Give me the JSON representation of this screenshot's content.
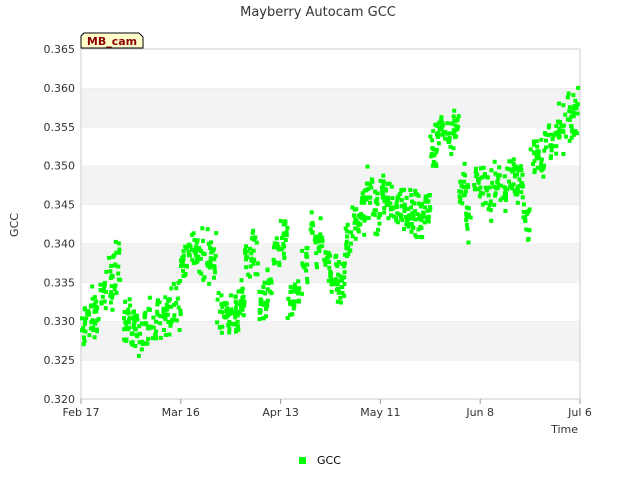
{
  "chart_data": {
    "type": "scatter",
    "title": "Mayberry Autocam GCC",
    "xlabel": "Time",
    "ylabel": "GCC",
    "xlim": [
      "2020-02-17",
      "2020-07-06"
    ],
    "ylim": [
      0.32,
      0.365
    ],
    "x_ticks": [
      {
        "date": "2020-02-17",
        "label": "Feb 17"
      },
      {
        "date": "2020-03-16",
        "label": "Mar 16"
      },
      {
        "date": "2020-04-13",
        "label": "Apr 13"
      },
      {
        "date": "2020-05-11",
        "label": "May 11"
      },
      {
        "date": "2020-06-08",
        "label": "Jun 8"
      },
      {
        "date": "2020-07-06",
        "label": "Jul 6"
      }
    ],
    "y_ticks": [
      "0.320",
      "0.325",
      "0.330",
      "0.335",
      "0.340",
      "0.345",
      "0.350",
      "0.355",
      "0.360",
      "0.365"
    ],
    "alternating_bands": true,
    "legend": {
      "position": "bottom-center",
      "entries": [
        "GCC"
      ]
    },
    "flag_label": "MB_cam",
    "series": [
      {
        "name": "GCC",
        "color": "#00ff00",
        "marker": "square",
        "daily_center": [
          [
            "2020-02-17",
            0.3285
          ],
          [
            "2020-02-19",
            0.33
          ],
          [
            "2020-02-21",
            0.331
          ],
          [
            "2020-02-23",
            0.3325
          ],
          [
            "2020-02-25",
            0.335
          ],
          [
            "2020-02-27",
            0.337
          ],
          [
            "2020-03-01",
            0.33
          ],
          [
            "2020-03-03",
            0.329
          ],
          [
            "2020-03-05",
            0.3285
          ],
          [
            "2020-03-07",
            0.33
          ],
          [
            "2020-03-09",
            0.33
          ],
          [
            "2020-03-11",
            0.331
          ],
          [
            "2020-03-13",
            0.331
          ],
          [
            "2020-03-15",
            0.332
          ],
          [
            "2020-03-17",
            0.337
          ],
          [
            "2020-03-19",
            0.339
          ],
          [
            "2020-03-21",
            0.3385
          ],
          [
            "2020-03-23",
            0.338
          ],
          [
            "2020-03-25",
            0.3385
          ],
          [
            "2020-03-27",
            0.331
          ],
          [
            "2020-03-29",
            0.33
          ],
          [
            "2020-03-31",
            0.331
          ],
          [
            "2020-04-02",
            0.332
          ],
          [
            "2020-04-04",
            0.338
          ],
          [
            "2020-04-06",
            0.3395
          ],
          [
            "2020-04-08",
            0.332
          ],
          [
            "2020-04-10",
            0.335
          ],
          [
            "2020-04-12",
            0.339
          ],
          [
            "2020-04-14",
            0.34
          ],
          [
            "2020-04-16",
            0.332
          ],
          [
            "2020-04-18",
            0.334
          ],
          [
            "2020-04-20",
            0.338
          ],
          [
            "2020-04-22",
            0.341
          ],
          [
            "2020-04-24",
            0.34
          ],
          [
            "2020-04-26",
            0.338
          ],
          [
            "2020-04-28",
            0.336
          ],
          [
            "2020-04-30",
            0.335
          ],
          [
            "2020-05-02",
            0.34
          ],
          [
            "2020-05-04",
            0.343
          ],
          [
            "2020-05-06",
            0.345
          ],
          [
            "2020-05-08",
            0.346
          ],
          [
            "2020-05-10",
            0.344
          ],
          [
            "2020-05-12",
            0.346
          ],
          [
            "2020-05-14",
            0.345
          ],
          [
            "2020-05-16",
            0.345
          ],
          [
            "2020-05-18",
            0.344
          ],
          [
            "2020-05-20",
            0.3445
          ],
          [
            "2020-05-22",
            0.343
          ],
          [
            "2020-05-24",
            0.345
          ],
          [
            "2020-05-26",
            0.353
          ],
          [
            "2020-05-28",
            0.354
          ],
          [
            "2020-05-30",
            0.3535
          ],
          [
            "2020-06-01",
            0.355
          ],
          [
            "2020-06-03",
            0.347
          ],
          [
            "2020-06-05",
            0.343
          ],
          [
            "2020-06-07",
            0.348
          ],
          [
            "2020-06-09",
            0.3475
          ],
          [
            "2020-06-11",
            0.346
          ],
          [
            "2020-06-13",
            0.348
          ],
          [
            "2020-06-15",
            0.347
          ],
          [
            "2020-06-17",
            0.349
          ],
          [
            "2020-06-19",
            0.348
          ],
          [
            "2020-06-21",
            0.343
          ],
          [
            "2020-06-23",
            0.351
          ],
          [
            "2020-06-25",
            0.35
          ],
          [
            "2020-06-27",
            0.353
          ],
          [
            "2020-06-29",
            0.354
          ],
          [
            "2020-07-01",
            0.355
          ],
          [
            "2020-07-03",
            0.356
          ],
          [
            "2020-07-05",
            0.357
          ]
        ]
      }
    ]
  }
}
